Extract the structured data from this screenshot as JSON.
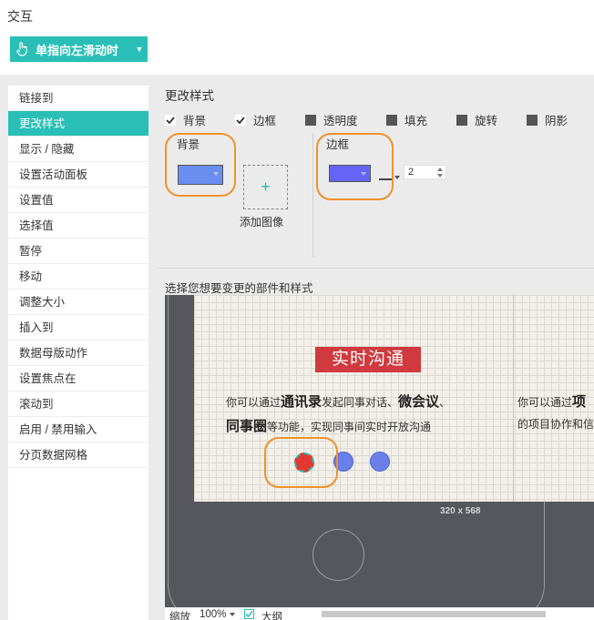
{
  "header": {
    "title": "交互"
  },
  "event": {
    "label": "单指向左滑动时",
    "hand_icon": "hand-pointer-icon",
    "caret_icon": "caret-down-icon"
  },
  "sidebar": {
    "items": [
      {
        "label": "链接到"
      },
      {
        "label": "更改样式",
        "active": true
      },
      {
        "label": "显示 / 隐藏"
      },
      {
        "label": "设置活动面板"
      },
      {
        "label": "设置值"
      },
      {
        "label": "选择值"
      },
      {
        "label": "暂停"
      },
      {
        "label": "移动"
      },
      {
        "label": "调整大小"
      },
      {
        "label": "插入到"
      },
      {
        "label": "数据母版动作"
      },
      {
        "label": "设置焦点在"
      },
      {
        "label": "滚动到"
      },
      {
        "label": "启用 / 禁用输入"
      },
      {
        "label": "分页数据网格"
      }
    ]
  },
  "main": {
    "title": "更改样式",
    "options": [
      {
        "label": "背景",
        "checked": true
      },
      {
        "label": "边框",
        "checked": true
      },
      {
        "label": "透明度",
        "checked": false
      },
      {
        "label": "填充",
        "checked": false
      },
      {
        "label": "旋转",
        "checked": false
      },
      {
        "label": "阴影",
        "checked": false
      }
    ],
    "background": {
      "label": "背景",
      "color": "#6a8df0",
      "add_image_label": "添加图像",
      "add_icon": "plus-icon"
    },
    "border": {
      "label": "边框",
      "color": "#6464f6",
      "width": "2",
      "line_icon": "line-style-icon"
    },
    "parts_label": "选择您想要变更的部件和样式",
    "highlight_color": "#f0912c"
  },
  "preview": {
    "slide_title": "实时沟通",
    "desc1": {
      "pre": "你可以通过",
      "bold1": "通讯录",
      "mid": "发起同事对话、",
      "bold2": "微会议",
      "post": "、"
    },
    "desc2": {
      "bold": "同事圈",
      "post": "等功能，实现同事间实时开放沟通"
    },
    "desc3": {
      "pre": "你可以通过",
      "bold": "项"
    },
    "desc4": "的项目协作和信",
    "size": "320 x 568",
    "colors": {
      "accent": "#29bfb6",
      "slide_red": "#d0393e",
      "slide_blue": "#3370cc",
      "dot": "#6a7fe8",
      "dot_selected": "#e3382f"
    }
  },
  "footer": {
    "zoom_label": "缩放",
    "zoom_value": "100%",
    "outline_label": "大纲",
    "outline_checked": true
  }
}
